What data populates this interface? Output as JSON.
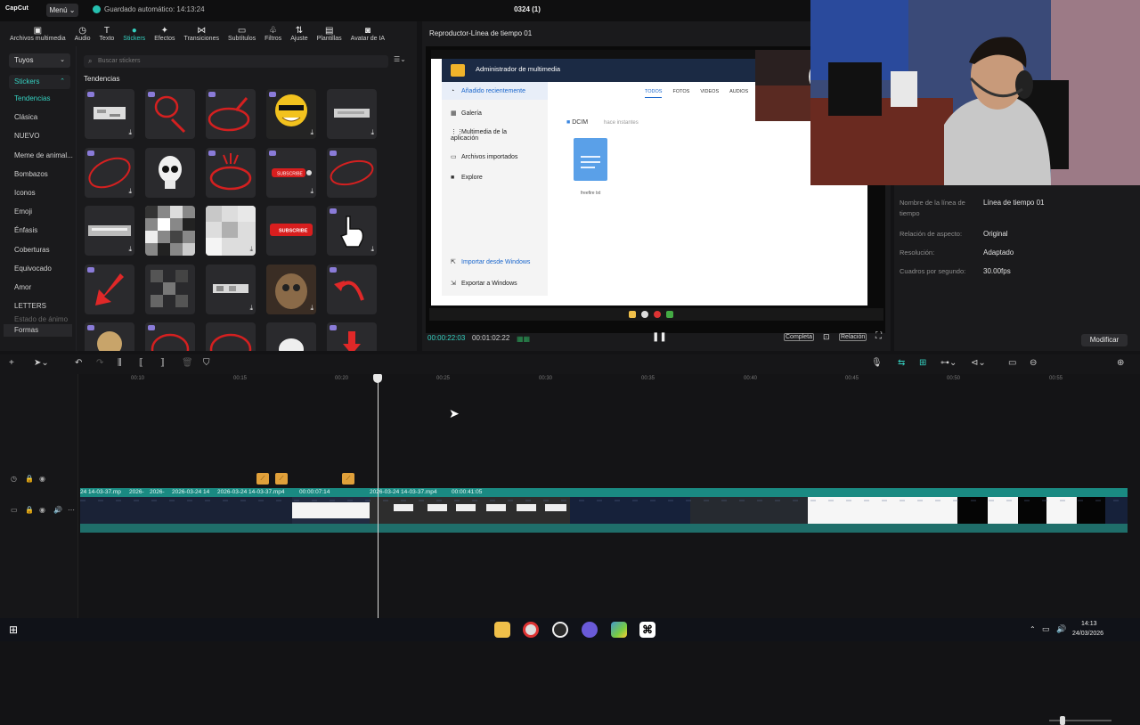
{
  "app": {
    "logo": "CapCut",
    "menu_label": "Menú",
    "autosave": "Guardado automático: 14:13:24",
    "project_title": "0324 (1)"
  },
  "tool_tabs": [
    {
      "label": "Archivos multimedia",
      "icon": "media-icon"
    },
    {
      "label": "Audio",
      "icon": "audio-icon"
    },
    {
      "label": "Texto",
      "icon": "text-icon"
    },
    {
      "label": "Stickers",
      "icon": "stickers-icon"
    },
    {
      "label": "Efectos",
      "icon": "effects-icon"
    },
    {
      "label": "Transiciones",
      "icon": "transitions-icon"
    },
    {
      "label": "Subtítulos",
      "icon": "subtitles-icon"
    },
    {
      "label": "Filtros",
      "icon": "filters-icon"
    },
    {
      "label": "Ajuste",
      "icon": "adjust-icon"
    },
    {
      "label": "Plantillas",
      "icon": "templates-icon"
    },
    {
      "label": "Avatar de IA",
      "icon": "ai-avatar-icon"
    }
  ],
  "categories": {
    "dropdown1": "Tuyos",
    "dropdown2": "Stickers",
    "items": [
      "Tendencias",
      "Clásica",
      "NUEVO",
      "Meme de animal...",
      "Bombazos",
      "Iconos",
      "Emoji",
      "Énfasis",
      "Coberturas",
      "Equivocado",
      "Amor",
      "LETTERS",
      "Estado de ánimo",
      "Formas"
    ]
  },
  "stickers": {
    "search_placeholder": "Buscar stickers",
    "section_title": "Tendencias",
    "subscribe_text": "SUBSCRIBE"
  },
  "player": {
    "title": "Reproductor-Línea de tiempo 01",
    "time_current": "00:00:22:03",
    "time_total": "00:01:02:22",
    "btn_completa": "Completa",
    "btn_relacion": "Relación"
  },
  "inner_screen": {
    "window_title": "Administrador de multimedia",
    "side": [
      "Añadido recientemente",
      "Galería",
      "Multimedia de la aplicación",
      "Archivos importados",
      "Explore",
      "Importar desde Windows",
      "Exportar a Windows"
    ],
    "tabs": [
      "TODOS",
      "FOTOS",
      "VIDEOS",
      "AUDIOS"
    ],
    "folder": "DCIM",
    "folder_time": "hace instantes",
    "file_name": "freefire txt"
  },
  "details": {
    "rows": [
      {
        "label": "Nombre de la línea de tiempo",
        "value": "Línea de tiempo 01"
      },
      {
        "label": "Relación de aspecto:",
        "value": "Original"
      },
      {
        "label": "Resolución:",
        "value": "Adaptado"
      },
      {
        "label": "Cuadros por segundo:",
        "value": "30.00fps"
      }
    ],
    "modify_label": "Modificar"
  },
  "timeline": {
    "ruler": [
      "00:10",
      "00:15",
      "00:20",
      "00:25",
      "00:30",
      "00:35",
      "00:40",
      "00:45",
      "00:50",
      "00:55"
    ],
    "clip_labels": [
      "24 14-03-37.mp",
      "2026-",
      "2026-",
      "2026-03-24 14",
      "2026-03-24 14-03-37.mp4",
      "00:00:07:14",
      "2026-03-24 14-03-37.mp4",
      "00:00:41:05"
    ]
  },
  "taskbar": {
    "time": "14:13",
    "date": "24/03/2026"
  },
  "colors": {
    "accent": "#35d0c0",
    "clip": "#1a8a82",
    "marker": "#e0a03a"
  }
}
